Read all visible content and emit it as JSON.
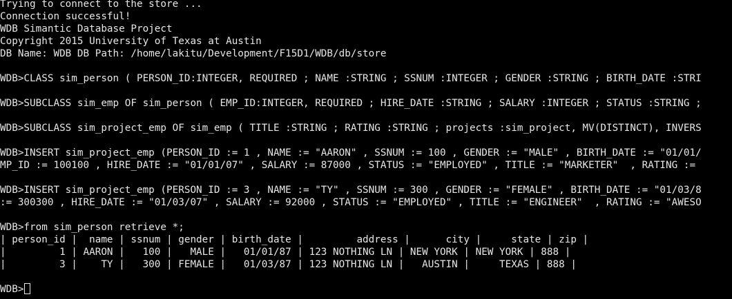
{
  "terminal": {
    "lines": [
      "Trying to connect to the store ...",
      "Connection successful!",
      "WDB Simantic Database Project",
      "Copyright 2015 University of Texas at Austin",
      "DB Name: WDB DB Path: /home/lakitu/Development/F15D1/WDB/db/store",
      "",
      "WDB>CLASS sim_person ( PERSON_ID:INTEGER, REQUIRED ; NAME :STRING ; SSNUM :INTEGER ; GENDER :STRING ; BIRTH_DATE :STRI",
      "",
      "WDB>SUBCLASS sim_emp OF sim_person ( EMP_ID:INTEGER, REQUIRED ; HIRE_DATE :STRING ; SALARY :INTEGER ; STATUS :STRING ;",
      "",
      "WDB>SUBCLASS sim_project_emp OF sim_emp ( TITLE :STRING ; RATING :STRING ; projects :sim_project, MV(DISTINCT), INVERS",
      "",
      "WDB>INSERT sim_project_emp (PERSON_ID := 1 , NAME := \"AARON\" , SSNUM := 100 , GENDER := \"MALE\" , BIRTH_DATE := \"01/01/",
      "MP_ID := 100100 , HIRE_DATE := \"01/01/07\" , SALARY := 87000 , STATUS := \"EMPLOYED\" , TITLE := \"MARKETER\"  , RATING :=",
      "",
      "WDB>INSERT sim_project_emp (PERSON_ID := 3 , NAME := \"TY\" , SSNUM := 300 , GENDER := \"FEMALE\" , BIRTH_DATE := \"01/03/8",
      ":= 300300 , HIRE_DATE := \"01/03/07\" , SALARY := 92000 , STATUS := \"EMPLOYED\" , TITLE := \"ENGINEER\"  , RATING := \"AWESO",
      "",
      "WDB>from sim_person retrieve *;",
      "| person_id |  name | ssnum | gender | birth_date |         address |      city |     state | zip |",
      "|         1 | AARON |   100 |   MALE |   01/01/87 | 123 NOTHING LN | NEW YORK | NEW YORK | 888 |",
      "|         3 |    TY |   300 | FEMALE |   01/03/87 | 123 NOTHING LN |   AUSTIN |     TEXAS | 888 |",
      "",
      "WDB>"
    ]
  }
}
